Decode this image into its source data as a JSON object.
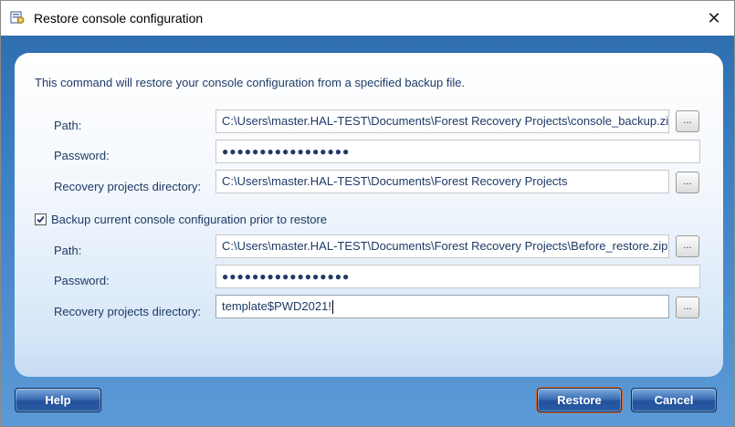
{
  "window": {
    "title": "Restore console configuration",
    "close_glyph": "✕",
    "icon": "app-config-icon"
  },
  "intro": "This command will restore your console configuration from a specified backup file.",
  "restore": {
    "path_label": "Path:",
    "path_value": "C:\\Users\\master.HAL-TEST\\Documents\\Forest Recovery Projects\\console_backup.zip",
    "password_label": "Password:",
    "password_value": "●●●●●●●●●●●●●●●●●",
    "projects_dir_label": "Recovery projects directory:",
    "projects_dir_value": "C:\\Users\\master.HAL-TEST\\Documents\\Forest Recovery Projects",
    "browse_label": "..."
  },
  "backup": {
    "checkbox_label": "Backup current console configuration prior to restore",
    "checked": true,
    "path_label": "Path:",
    "path_value": "C:\\Users\\master.HAL-TEST\\Documents\\Forest Recovery Projects\\Before_restore.zip",
    "password_label": "Password:",
    "password_value": "●●●●●●●●●●●●●●●●●",
    "projects_dir_label": "Recovery projects directory:",
    "projects_dir_value": "template$PWD2021!",
    "browse_label": "..."
  },
  "buttons": {
    "help": "Help",
    "restore": "Restore",
    "cancel": "Cancel"
  },
  "colors": {
    "accent_blue": "#2a5da6",
    "label_text": "#1f3a66",
    "default_button_outline": "#e06a2a"
  }
}
